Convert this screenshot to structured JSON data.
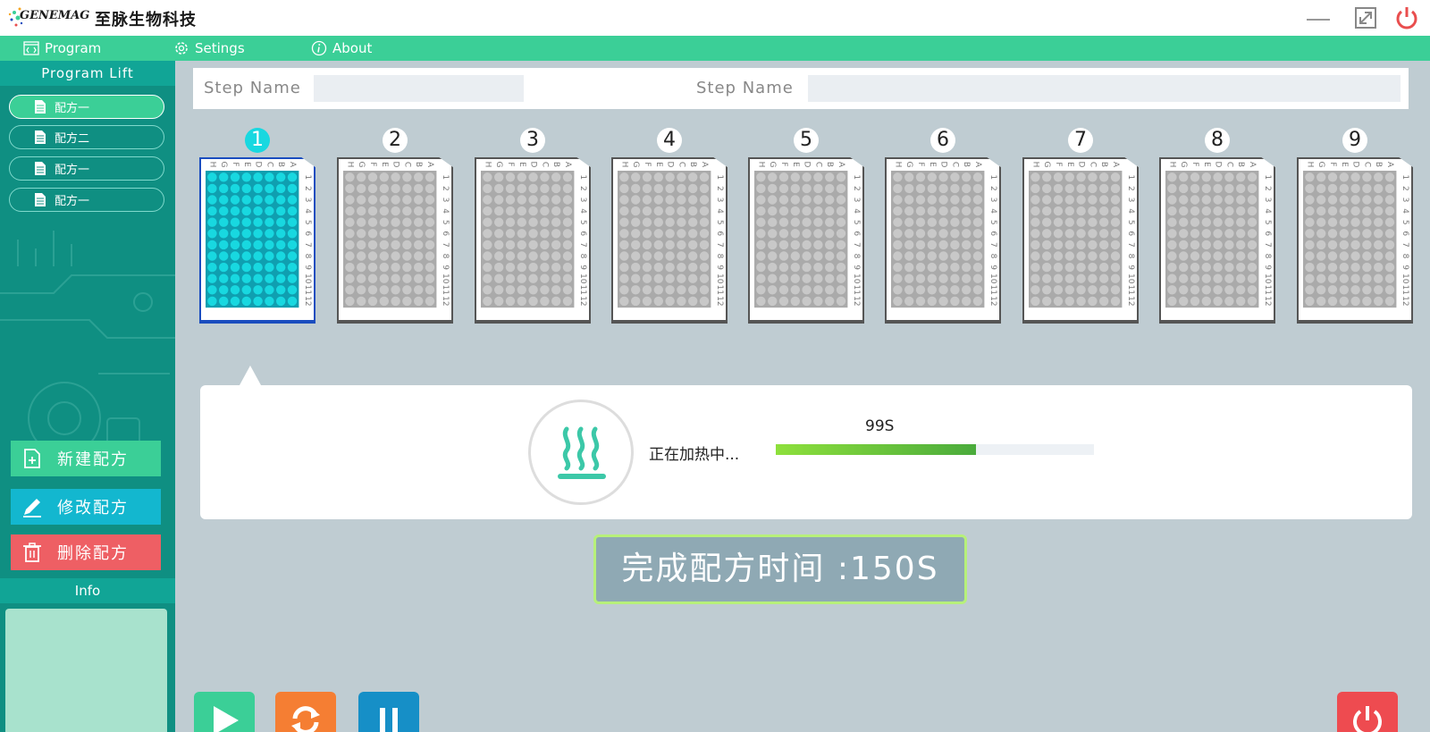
{
  "app": {
    "logo_text": "GENEMAG",
    "company_name": "至脉生物科技"
  },
  "menu": [
    {
      "label": "Program",
      "icon": "code-window-icon"
    },
    {
      "label": "Setings",
      "icon": "gear-icon"
    },
    {
      "label": "About",
      "icon": "info-icon"
    }
  ],
  "sidebar": {
    "header": "Program Lift",
    "recipes": [
      "配方一",
      "配方二",
      "配方一",
      "配方一"
    ],
    "active_recipe_index": 0,
    "new_label": "新建配方",
    "edit_label": "修改配方",
    "delete_label": "删除配方",
    "info_header": "Info"
  },
  "step_bar": {
    "label_1": "Step Name",
    "value_1": "",
    "label_2": "Step Name",
    "value_2": ""
  },
  "plates": {
    "numbers": [
      "1",
      "2",
      "3",
      "4",
      "5",
      "6",
      "7",
      "8",
      "9"
    ],
    "active_index": 0,
    "row_letters": [
      "A",
      "B",
      "C",
      "D",
      "E",
      "F",
      "G",
      "H"
    ],
    "col_numbers": [
      "1",
      "2",
      "3",
      "4",
      "5",
      "6",
      "7",
      "8",
      "9",
      "10",
      "11",
      "12"
    ]
  },
  "status": {
    "heating_text": "正在加热中...",
    "progress_value": "99S",
    "progress_fraction": 0.63,
    "finish_text": "完成配方时间 :150S"
  },
  "colors": {
    "accent": "#3bcf97",
    "sidebar": "#0f8f82",
    "active_well": "#18d8e0",
    "inactive_well": "#c8c8c8"
  }
}
